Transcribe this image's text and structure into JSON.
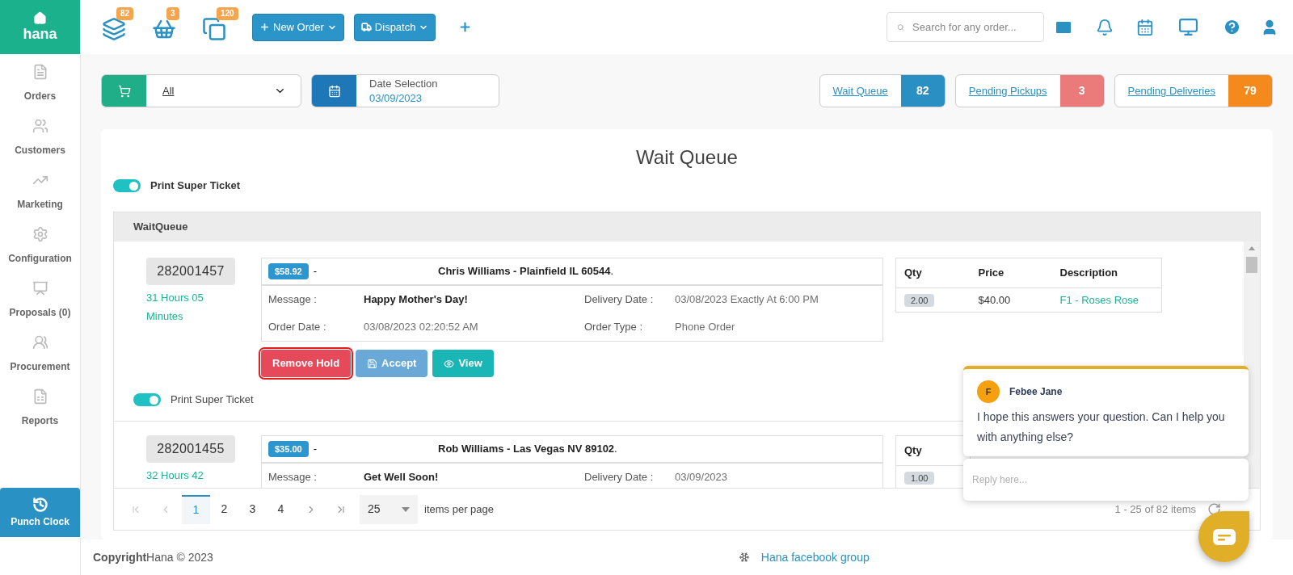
{
  "brand": {
    "name": "hana"
  },
  "top_actions": [
    {
      "kind": "queue",
      "count": "82"
    },
    {
      "kind": "basket",
      "count": "3"
    },
    {
      "kind": "copies",
      "count": "120"
    }
  ],
  "top_buttons": [
    {
      "kind": "new",
      "label": "New Order"
    },
    {
      "kind": "dispatch",
      "label": "Dispatch"
    }
  ],
  "search": {
    "placeholder": "Search for any order..."
  },
  "sidebar": {
    "items": [
      {
        "kind": "orders",
        "label": "Orders"
      },
      {
        "kind": "customers",
        "label": "Customers"
      },
      {
        "kind": "marketing",
        "label": "Marketing"
      },
      {
        "kind": "configuration",
        "label": "Configuration"
      },
      {
        "kind": "proposals",
        "label": "Proposals (0)"
      },
      {
        "kind": "procurement",
        "label": "Procurement"
      },
      {
        "kind": "reports",
        "label": "Reports"
      }
    ],
    "punch_clock": "Punch Clock"
  },
  "filters": {
    "store": {
      "value": "All"
    },
    "date": {
      "label": "Date Selection",
      "value": "03/09/2023"
    }
  },
  "stats": [
    {
      "label": "Wait Queue",
      "count": "82",
      "color": "#2a8fc2"
    },
    {
      "label": "Pending Pickups",
      "count": "3",
      "color": "#eb7b7b"
    },
    {
      "label": "Pending Deliveries",
      "count": "79",
      "color": "#f48a1c"
    }
  ],
  "page_title": "Wait Queue",
  "print_super_ticket": {
    "label": "Print Super Ticket",
    "on": true
  },
  "panel": {
    "title": "WaitQueue"
  },
  "orders": [
    {
      "number": "282001457",
      "elapsed": "31 Hours 05 Minutes",
      "price": "$58.92",
      "separator": "-",
      "customer": "**Chris Williams - Plainfield IL 60544**.",
      "fields": [
        {
          "label": "Message :",
          "value": "Happy Mother's Day!",
          "emphasis": true
        },
        {
          "label": "Delivery Date :",
          "value": "03/08/2023 Exactly At 6:00 PM",
          "emphasis": false
        },
        {
          "label": "Order Date :",
          "value": "03/08/2023 02:20:52 AM",
          "emphasis": false
        },
        {
          "label": "Order Type :",
          "value": "Phone Order",
          "emphasis": false
        }
      ],
      "items": {
        "columns": [
          "Qty",
          "Price",
          "Description"
        ],
        "rows": [
          {
            "cells": [
              "2.00",
              "$40.00",
              "F1 - Roses Rose"
            ]
          }
        ]
      },
      "actions": [
        {
          "kind": "remove",
          "label": "Remove Hold",
          "focused": true
        },
        {
          "kind": "accept",
          "label": "Accept",
          "focused": false
        },
        {
          "kind": "view",
          "label": "View",
          "focused": false
        }
      ],
      "print_toggle": {
        "label": "Print Super Ticket",
        "on": true
      }
    },
    {
      "number": "282001455",
      "elapsed": "32 Hours 42",
      "price": "$35.00",
      "separator": "-",
      "customer": "**Rob Williams - Las Vegas NV 89102**.",
      "fields": [
        {
          "label": "Message :",
          "value": "Get Well Soon!",
          "emphasis": true
        },
        {
          "label": "Delivery Date :",
          "value": "03/09/2023",
          "emphasis": false
        }
      ],
      "items": {
        "columns": [
          "Qty"
        ],
        "rows": [
          {
            "cells": [
              "1.00"
            ]
          }
        ]
      }
    }
  ],
  "pager": {
    "pages": [
      {
        "label": "1",
        "selected": true
      },
      {
        "label": "2",
        "selected": false
      },
      {
        "label": "3",
        "selected": false
      },
      {
        "label": "4",
        "selected": false
      }
    ],
    "page_size": "25",
    "page_size_label": "items per page",
    "summary": "1 - 25 of 82 items"
  },
  "chat": {
    "initial": "F",
    "agent": "Febee Jane",
    "message": "I hope this answers your question. Can I help you with anything else?",
    "reply_placeholder": "Reply here..."
  },
  "footer": {
    "copyright": "**Copyright**Hana © 2023",
    "link": "Hana facebook group"
  }
}
